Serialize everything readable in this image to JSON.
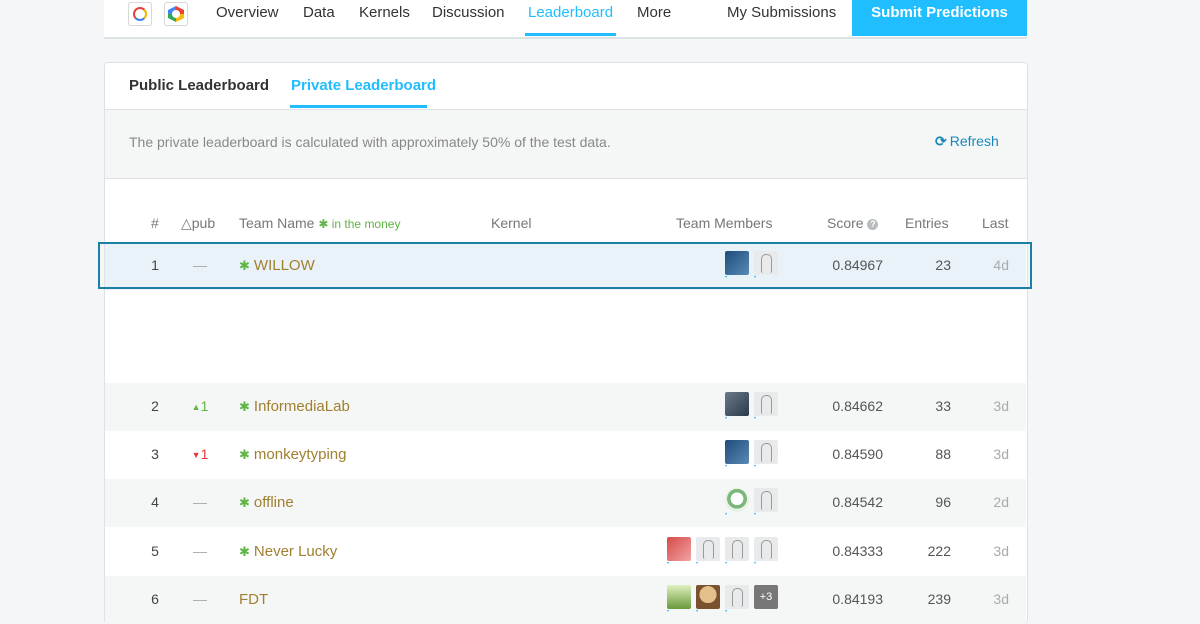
{
  "nav": {
    "items": [
      "Overview",
      "Data",
      "Kernels",
      "Discussion",
      "Leaderboard",
      "More"
    ],
    "active": "Leaderboard",
    "my_submissions": "My Submissions",
    "submit": "Submit Predictions"
  },
  "tabs": {
    "public": "Public Leaderboard",
    "private": "Private Leaderboard",
    "active": "Private Leaderboard"
  },
  "info": {
    "text": "The private leaderboard is calculated with approximately 50% of the test data.",
    "refresh": "Refresh"
  },
  "columns": {
    "rank": "#",
    "delta": "△pub",
    "team": "Team Name",
    "money": "in the money",
    "kernel": "Kernel",
    "members": "Team Members",
    "score": "Score",
    "entries": "Entries",
    "last": "Last"
  },
  "rows": [
    {
      "rank": "1",
      "delta": "—",
      "team": "WILLOW",
      "money": true,
      "score": "0.84967",
      "entries": "23",
      "last": "4d",
      "members": [
        "photo",
        "default"
      ]
    },
    {
      "rank": "2",
      "delta": "1",
      "delta_dir": "up",
      "team": "InformediaLab",
      "money": true,
      "score": "0.84662",
      "entries": "33",
      "last": "3d",
      "members": [
        "photo2",
        "default"
      ]
    },
    {
      "rank": "3",
      "delta": "1",
      "delta_dir": "down",
      "team": "monkeytyping",
      "money": true,
      "score": "0.84590",
      "entries": "88",
      "last": "3d",
      "members": [
        "photo",
        "default"
      ]
    },
    {
      "rank": "4",
      "delta": "—",
      "team": "offline",
      "money": true,
      "score": "0.84542",
      "entries": "96",
      "last": "2d",
      "members": [
        "green",
        "default"
      ]
    },
    {
      "rank": "5",
      "delta": "—",
      "team": "Never Lucky",
      "money": true,
      "score": "0.84333",
      "entries": "222",
      "last": "3d",
      "members": [
        "red",
        "default",
        "default",
        "default"
      ]
    },
    {
      "rank": "6",
      "delta": "—",
      "team": "FDT",
      "money": false,
      "score": "0.84193",
      "entries": "239",
      "last": "3d",
      "members": [
        "nature",
        "dog",
        "default",
        "+3"
      ]
    }
  ],
  "colors": {
    "accent": "#20beff",
    "team_link": "#a08030",
    "money": "#5fb543",
    "down": "#e43a3a"
  }
}
